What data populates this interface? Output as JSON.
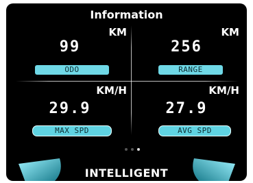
{
  "header": {
    "title": "Information"
  },
  "tiles": [
    {
      "unit": "KM",
      "value": "99",
      "label": "ODO"
    },
    {
      "unit": "KM",
      "value": "256",
      "label": "RANGE"
    },
    {
      "unit": "KM/H",
      "value": "29.9",
      "label": "MAX SPD"
    },
    {
      "unit": "KM/H",
      "value": "27.9",
      "label": "AVG SPD"
    }
  ],
  "pager": {
    "count": 3,
    "active": 2
  },
  "footer": {
    "mode": "INTELLIGENT"
  },
  "colors": {
    "accent": "#6fd8e6",
    "background": "#000000",
    "text": "#ffffff"
  }
}
